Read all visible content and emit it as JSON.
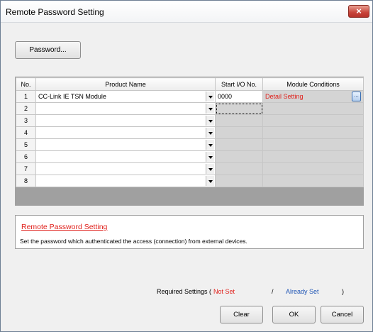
{
  "window": {
    "title": "Remote Password Setting",
    "close_label": "×"
  },
  "password_button": "Password...",
  "table": {
    "headers": [
      "No.",
      "Product Name",
      "Start I/O No.",
      "Module Conditions"
    ],
    "rows": [
      {
        "no": "1",
        "product": "CC-Link IE TSN Module",
        "io": "0000",
        "module": "Detail Setting",
        "ellipsis": "..."
      },
      {
        "no": "2",
        "product": "",
        "io": "",
        "module": ""
      },
      {
        "no": "3",
        "product": "",
        "io": "",
        "module": ""
      },
      {
        "no": "4",
        "product": "",
        "io": "",
        "module": ""
      },
      {
        "no": "5",
        "product": "",
        "io": "",
        "module": ""
      },
      {
        "no": "6",
        "product": "",
        "io": "",
        "module": ""
      },
      {
        "no": "7",
        "product": "",
        "io": "",
        "module": ""
      },
      {
        "no": "8",
        "product": "",
        "io": "",
        "module": ""
      }
    ]
  },
  "description": {
    "title": "Remote Password Setting",
    "text": "Set the password which authenticated the access (connection) from external devices."
  },
  "required_settings": {
    "label": "Required Settings (",
    "not_set": "Not Set",
    "separator": "/",
    "already_set": "Already Set",
    "close_paren": ")"
  },
  "buttons": {
    "clear": "Clear",
    "ok": "OK",
    "cancel": "Cancel"
  },
  "colors": {
    "not_set": "#e0201b",
    "already_set": "#1f55b5"
  }
}
